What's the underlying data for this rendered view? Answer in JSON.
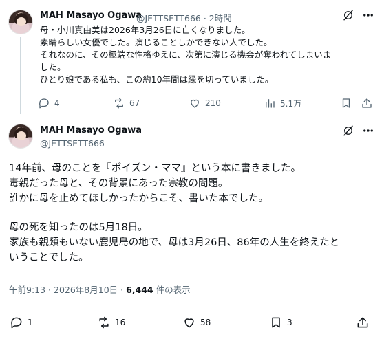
{
  "post1": {
    "author_name": "MAH Masayo Ogawa",
    "handle_time": "@JETTSETT666 · 2時間",
    "lines": [
      "母・小川真由美は2026年3月26日に亡くなりました。",
      "素晴らしい女優でした。演じることしかできない人でした。",
      "それなのに、その極端な性格ゆえに、次第に演じる機会が奪われてしまいま",
      "した。",
      "ひとり娘である私も、この約10年間は縁を切っていました。"
    ],
    "actions": {
      "replies": "4",
      "reposts": "67",
      "likes": "210",
      "views": "5.1万"
    }
  },
  "post2": {
    "author_name": "MAH Masayo Ogawa",
    "handle": "@JETTSETT666",
    "lines": [
      "14年前、母のことを『ポイズン・ママ』という本に書きました。",
      "毒親だった母と、その背景にあった宗教の問題。",
      "誰かに母を止めてほしかったからこそ、書いた本でした。",
      "",
      "母の死を知ったのは5月18日。",
      "家族も親類もいない鹿児島の地で、母は3月26日、86年の人生を終えたと",
      "いうことでした。"
    ],
    "timestamp": "午前9:13 · 2026年8月10日 · ",
    "views_count": "6,444",
    "views_label": " 件の表示",
    "actions": {
      "replies": "1",
      "reposts": "16",
      "likes": "58",
      "bookmarks": "3"
    }
  },
  "icons": [
    "grok-icon",
    "more-icon",
    "reply-icon",
    "repost-icon",
    "like-icon",
    "views-icon",
    "bookmark-icon",
    "share-icon"
  ]
}
